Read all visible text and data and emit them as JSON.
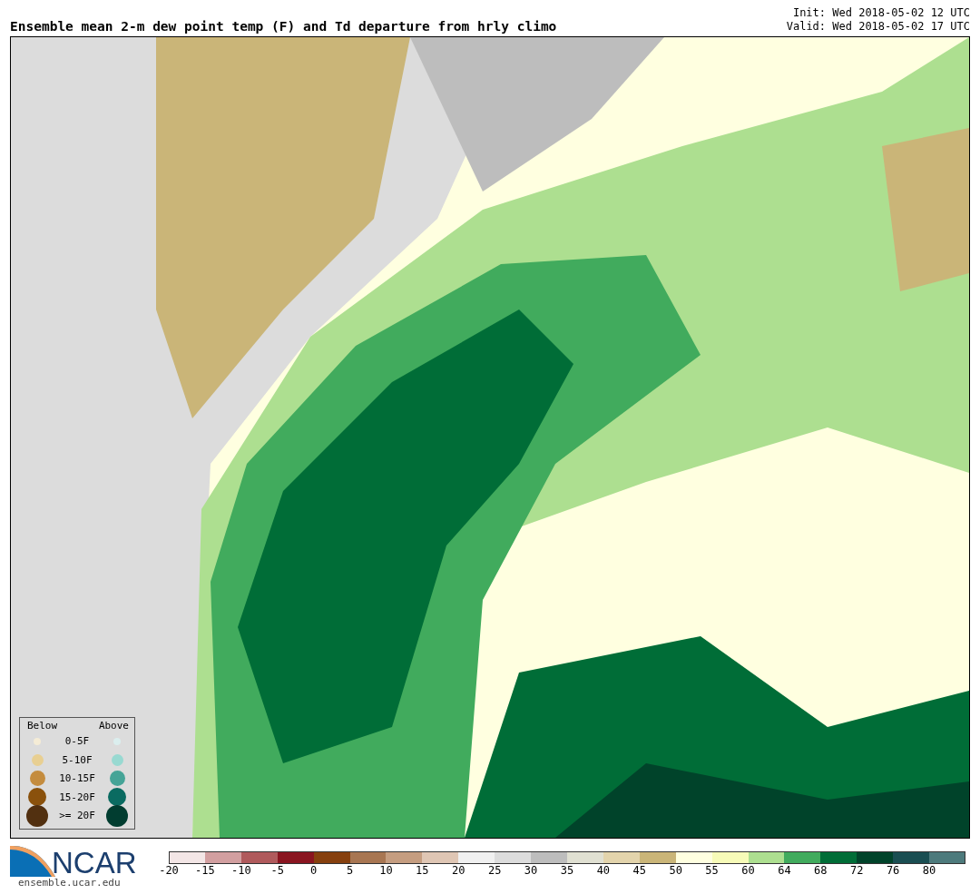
{
  "title": "Ensemble mean 2-m dew point temp (F) and Td departure from hrly climo",
  "init": "Init: Wed 2018-05-02 12 UTC",
  "valid": "Valid: Wed 2018-05-02 17 UTC",
  "legend": {
    "below_heading": "Below",
    "above_heading": "Above",
    "entries": [
      {
        "label": "0-5F",
        "below": {
          "color": "#f5ecd6"
        },
        "above": {
          "color": "#dbeeee"
        }
      },
      {
        "label": "5-10F",
        "below": {
          "color": "#e8cf92"
        },
        "above": {
          "color": "#98d9d1"
        }
      },
      {
        "label": "10-15F",
        "below": {
          "color": "#c48c3e"
        },
        "above": {
          "color": "#45a497"
        }
      },
      {
        "label": "15-20F",
        "below": {
          "color": "#8a510c"
        },
        "above": {
          "color": "#0a6b61"
        }
      },
      {
        "label": ">= 20F",
        "below": {
          "color": "#523010"
        },
        "above": {
          "color": "#013d30"
        }
      }
    ]
  },
  "logo": {
    "text": "NCAR",
    "url": "ensemble.ucar.edu"
  },
  "colorbar": {
    "segments": [
      {
        "color": "#f3e6e6",
        "tick": "-20"
      },
      {
        "color": "#d29fa0",
        "tick": "-15"
      },
      {
        "color": "#b05a5c",
        "tick": "-10"
      },
      {
        "color": "#8a1520",
        "tick": "-5"
      },
      {
        "color": "#86400e",
        "tick": "0"
      },
      {
        "color": "#a87652",
        "tick": "5"
      },
      {
        "color": "#c59d80",
        "tick": "10"
      },
      {
        "color": "#dfc6b4",
        "tick": "15"
      },
      {
        "color": "#f0f0f0",
        "tick": "20"
      },
      {
        "color": "#dcdcdc",
        "tick": "25"
      },
      {
        "color": "#bdbdbd",
        "tick": "30"
      },
      {
        "color": "#e0e0d2",
        "tick": "35"
      },
      {
        "color": "#e3d4ac",
        "tick": "40"
      },
      {
        "color": "#cab578",
        "tick": "45"
      },
      {
        "color": "#ffffe0",
        "tick": "50"
      },
      {
        "color": "#f7fbb8",
        "tick": "55"
      },
      {
        "color": "#addf90",
        "tick": "60"
      },
      {
        "color": "#41ab5d",
        "tick": "64"
      },
      {
        "color": "#006d37",
        "tick": "68"
      },
      {
        "color": "#00432a",
        "tick": "72"
      },
      {
        "color": "#1a4e52",
        "tick": "76"
      },
      {
        "color": "#4d7a7c",
        "tick": "80"
      }
    ]
  }
}
